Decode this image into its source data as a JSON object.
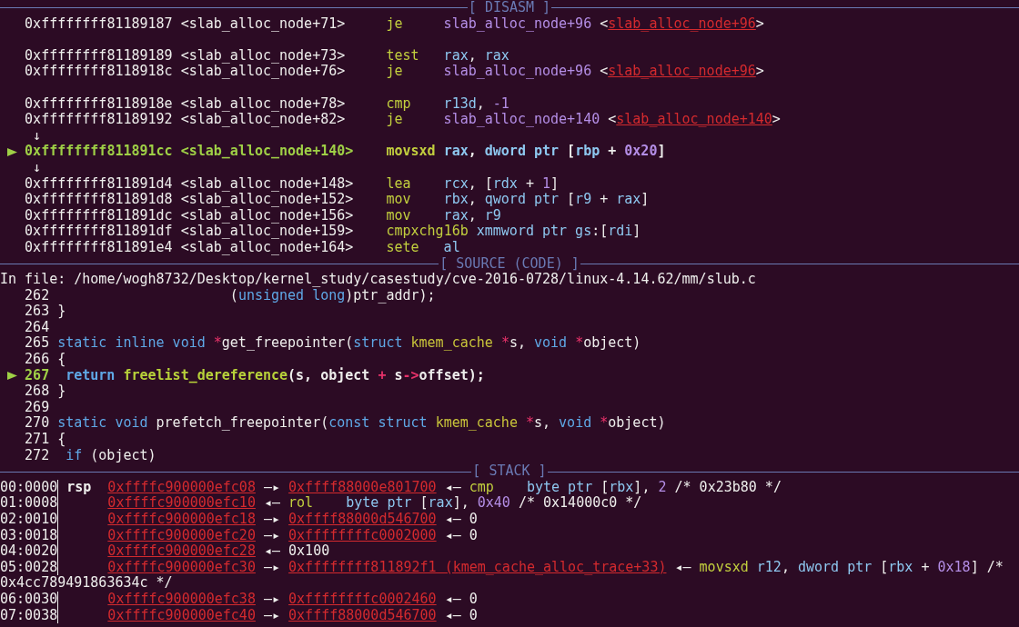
{
  "disasm": {
    "title": "[ DISASM ]",
    "lines": [
      {
        "kind": "instruction",
        "current": false,
        "address": "0xffffffff81189187",
        "symbol": "<slab_alloc_node+71>",
        "mnemonic": "je",
        "operands": [
          {
            "kind": "sym",
            "text": "slab_alloc_node+96"
          },
          {
            "kind": "plain",
            "text": " <"
          },
          {
            "kind": "link",
            "text": "slab_alloc_node+96"
          },
          {
            "kind": "plain",
            "text": ">"
          }
        ]
      },
      {
        "kind": "blank"
      },
      {
        "kind": "instruction",
        "current": false,
        "address": "0xffffffff81189189",
        "symbol": "<slab_alloc_node+73>",
        "mnemonic": "test",
        "operands": [
          {
            "kind": "reg",
            "text": "rax"
          },
          {
            "kind": "plain",
            "text": ", "
          },
          {
            "kind": "reg",
            "text": "rax"
          }
        ]
      },
      {
        "kind": "instruction",
        "current": false,
        "address": "0xffffffff8118918c",
        "symbol": "<slab_alloc_node+76>",
        "mnemonic": "je",
        "operands": [
          {
            "kind": "sym",
            "text": "slab_alloc_node+96"
          },
          {
            "kind": "plain",
            "text": " <"
          },
          {
            "kind": "link",
            "text": "slab_alloc_node+96"
          },
          {
            "kind": "plain",
            "text": ">"
          }
        ]
      },
      {
        "kind": "blank"
      },
      {
        "kind": "instruction",
        "current": false,
        "address": "0xffffffff8118918e",
        "symbol": "<slab_alloc_node+78>",
        "mnemonic": "cmp",
        "operands": [
          {
            "kind": "reg",
            "text": "r13d"
          },
          {
            "kind": "plain",
            "text": ", "
          },
          {
            "kind": "num",
            "text": "-1"
          }
        ]
      },
      {
        "kind": "instruction",
        "current": false,
        "address": "0xffffffff81189192",
        "symbol": "<slab_alloc_node+82>",
        "mnemonic": "je",
        "operands": [
          {
            "kind": "sym",
            "text": "slab_alloc_node+140"
          },
          {
            "kind": "plain",
            "text": " <"
          },
          {
            "kind": "link",
            "text": "slab_alloc_node+140"
          },
          {
            "kind": "plain",
            "text": ">"
          }
        ]
      },
      {
        "kind": "flow_arrow",
        "text": "↓"
      },
      {
        "kind": "instruction",
        "current": true,
        "address": "0xffffffff811891cc",
        "symbol": "<slab_alloc_node+140>",
        "mnemonic": "movsxd",
        "operands": [
          {
            "kind": "reg",
            "text": "rax"
          },
          {
            "kind": "plain",
            "text": ", "
          },
          {
            "kind": "reg",
            "text": "dword ptr"
          },
          {
            "kind": "plain",
            "text": " ["
          },
          {
            "kind": "reg",
            "text": "rbp"
          },
          {
            "kind": "plain",
            "text": " + "
          },
          {
            "kind": "num",
            "text": "0x20"
          },
          {
            "kind": "plain",
            "text": "]"
          }
        ]
      },
      {
        "kind": "flow_arrow",
        "text": "↓"
      },
      {
        "kind": "instruction",
        "current": false,
        "address": "0xffffffff811891d4",
        "symbol": "<slab_alloc_node+148>",
        "mnemonic": "lea",
        "operands": [
          {
            "kind": "reg",
            "text": "rcx"
          },
          {
            "kind": "plain",
            "text": ", ["
          },
          {
            "kind": "reg",
            "text": "rdx"
          },
          {
            "kind": "plain",
            "text": " + "
          },
          {
            "kind": "num",
            "text": "1"
          },
          {
            "kind": "plain",
            "text": "]"
          }
        ]
      },
      {
        "kind": "instruction",
        "current": false,
        "address": "0xffffffff811891d8",
        "symbol": "<slab_alloc_node+152>",
        "mnemonic": "mov",
        "operands": [
          {
            "kind": "reg",
            "text": "rbx"
          },
          {
            "kind": "plain",
            "text": ", "
          },
          {
            "kind": "reg",
            "text": "qword ptr"
          },
          {
            "kind": "plain",
            "text": " ["
          },
          {
            "kind": "reg",
            "text": "r9"
          },
          {
            "kind": "plain",
            "text": " + "
          },
          {
            "kind": "reg",
            "text": "rax"
          },
          {
            "kind": "plain",
            "text": "]"
          }
        ]
      },
      {
        "kind": "instruction",
        "current": false,
        "address": "0xffffffff811891dc",
        "symbol": "<slab_alloc_node+156>",
        "mnemonic": "mov",
        "operands": [
          {
            "kind": "reg",
            "text": "rax"
          },
          {
            "kind": "plain",
            "text": ", "
          },
          {
            "kind": "reg",
            "text": "r9"
          }
        ]
      },
      {
        "kind": "instruction",
        "current": false,
        "address": "0xffffffff811891df",
        "symbol": "<slab_alloc_node+159>",
        "mnemonic": "cmpxchg16b",
        "operands": [
          {
            "kind": "reg",
            "text": "xmmword ptr gs"
          },
          {
            "kind": "plain",
            "text": ":["
          },
          {
            "kind": "reg",
            "text": "rdi"
          },
          {
            "kind": "plain",
            "text": "]"
          }
        ]
      },
      {
        "kind": "instruction",
        "current": false,
        "address": "0xffffffff811891e4",
        "symbol": "<slab_alloc_node+164>",
        "mnemonic": "sete",
        "operands": [
          {
            "kind": "reg",
            "text": "al"
          }
        ]
      }
    ]
  },
  "source": {
    "title": "[ SOURCE (CODE) ]",
    "file": "In file: /home/wogh8732/Desktop/kernel_study/casestudy/cve-2016-0728/linux-4.14.62/mm/slub.c",
    "lines": [
      {
        "number": "262",
        "current": false,
        "code": [
          {
            "kind": "plain",
            "text": "                     ("
          },
          {
            "kind": "kw",
            "text": "unsigned long"
          },
          {
            "kind": "plain",
            "text": ")ptr_addr);"
          }
        ]
      },
      {
        "number": "263",
        "current": false,
        "code": [
          {
            "kind": "plain",
            "text": "}"
          }
        ]
      },
      {
        "number": "264",
        "current": false
      },
      {
        "number": "265",
        "current": false,
        "code": [
          {
            "kind": "kw",
            "text": "static inline void "
          },
          {
            "kind": "op",
            "text": "*"
          },
          {
            "kind": "plain",
            "text": "get_freepointer("
          },
          {
            "kind": "kw",
            "text": "struct "
          },
          {
            "kind": "type",
            "text": "kmem_cache "
          },
          {
            "kind": "op",
            "text": "*"
          },
          {
            "kind": "plain",
            "text": "s, "
          },
          {
            "kind": "kw",
            "text": "void "
          },
          {
            "kind": "op",
            "text": "*"
          },
          {
            "kind": "plain",
            "text": "object)"
          }
        ]
      },
      {
        "number": "266",
        "current": false,
        "code": [
          {
            "kind": "plain",
            "text": "{"
          }
        ]
      },
      {
        "number": "267",
        "current": true,
        "code": [
          {
            "kind": "kw",
            "text": " return "
          },
          {
            "kind": "func",
            "text": "freelist_dereference"
          },
          {
            "kind": "plain",
            "text": "(s, object "
          },
          {
            "kind": "op",
            "text": "+"
          },
          {
            "kind": "plain",
            "text": " s"
          },
          {
            "kind": "op",
            "text": "->"
          },
          {
            "kind": "plain",
            "text": "offset);"
          }
        ]
      },
      {
        "number": "268",
        "current": false,
        "code": [
          {
            "kind": "plain",
            "text": "}"
          }
        ]
      },
      {
        "number": "269",
        "current": false
      },
      {
        "number": "270",
        "current": false,
        "code": [
          {
            "kind": "kw",
            "text": "static void"
          },
          {
            "kind": "plain",
            "text": " prefetch_freepointer("
          },
          {
            "kind": "kw",
            "text": "const struct "
          },
          {
            "kind": "type",
            "text": "kmem_cache "
          },
          {
            "kind": "op",
            "text": "*"
          },
          {
            "kind": "plain",
            "text": "s, "
          },
          {
            "kind": "kw",
            "text": "void "
          },
          {
            "kind": "op",
            "text": "*"
          },
          {
            "kind": "plain",
            "text": "object)"
          }
        ]
      },
      {
        "number": "271",
        "current": false,
        "code": [
          {
            "kind": "plain",
            "text": "{"
          }
        ]
      },
      {
        "number": "272",
        "current": false,
        "code": [
          {
            "kind": "kw",
            "text": " if"
          },
          {
            "kind": "plain",
            "text": " (object)"
          }
        ]
      }
    ]
  },
  "stack": {
    "title": "[ STACK ]",
    "lines": [
      {
        "kind": "entry",
        "offset": "00:0000",
        "register": "rsp",
        "segs": [
          {
            "kind": "link",
            "text": "0xffffc900000efc08"
          },
          {
            "kind": "plain",
            "text": " —▸ "
          },
          {
            "kind": "link",
            "text": "0xffff88000e801700"
          },
          {
            "kind": "plain",
            "text": " ◂— "
          },
          {
            "kind": "mnem",
            "text": "cmp    "
          },
          {
            "kind": "reg",
            "text": "byte ptr"
          },
          {
            "kind": "plain",
            "text": " ["
          },
          {
            "kind": "reg",
            "text": "rbx"
          },
          {
            "kind": "plain",
            "text": "], "
          },
          {
            "kind": "num",
            "text": "2"
          },
          {
            "kind": "plain",
            "text": " /* 0x23b80 */"
          }
        ]
      },
      {
        "kind": "entry",
        "offset": "01:0008",
        "segs": [
          {
            "kind": "link",
            "text": "0xffffc900000efc10"
          },
          {
            "kind": "plain",
            "text": " ◂— "
          },
          {
            "kind": "mnem",
            "text": "rol    "
          },
          {
            "kind": "reg",
            "text": "byte ptr"
          },
          {
            "kind": "plain",
            "text": " ["
          },
          {
            "kind": "reg",
            "text": "rax"
          },
          {
            "kind": "plain",
            "text": "], "
          },
          {
            "kind": "num",
            "text": "0x40"
          },
          {
            "kind": "plain",
            "text": " /* 0x14000c0 */"
          }
        ]
      },
      {
        "kind": "entry",
        "offset": "02:0010",
        "segs": [
          {
            "kind": "link",
            "text": "0xffffc900000efc18"
          },
          {
            "kind": "plain",
            "text": " —▸ "
          },
          {
            "kind": "link",
            "text": "0xffff88000d546700"
          },
          {
            "kind": "plain",
            "text": " ◂— 0"
          }
        ]
      },
      {
        "kind": "entry",
        "offset": "03:0018",
        "segs": [
          {
            "kind": "link",
            "text": "0xffffc900000efc20"
          },
          {
            "kind": "plain",
            "text": " —▸ "
          },
          {
            "kind": "link",
            "text": "0xffffffffc0002000"
          },
          {
            "kind": "plain",
            "text": " ◂— 0"
          }
        ]
      },
      {
        "kind": "entry",
        "offset": "04:0020",
        "segs": [
          {
            "kind": "link",
            "text": "0xffffc900000efc28"
          },
          {
            "kind": "plain",
            "text": " ◂— 0x100"
          }
        ]
      },
      {
        "kind": "entry",
        "offset": "05:0028",
        "segs": [
          {
            "kind": "link",
            "text": "0xffffc900000efc30"
          },
          {
            "kind": "plain",
            "text": " —▸ "
          },
          {
            "kind": "link",
            "text": "0xffffffff811892f1 (kmem_cache_alloc_trace+33)"
          },
          {
            "kind": "plain",
            "text": " ◂— "
          },
          {
            "kind": "mnem",
            "text": "movsxd "
          },
          {
            "kind": "reg",
            "text": "r12"
          },
          {
            "kind": "plain",
            "text": ", "
          },
          {
            "kind": "reg",
            "text": "dword ptr"
          },
          {
            "kind": "plain",
            "text": " ["
          },
          {
            "kind": "reg",
            "text": "rbx"
          },
          {
            "kind": "plain",
            "text": " + "
          },
          {
            "kind": "num",
            "text": "0x18"
          },
          {
            "kind": "plain",
            "text": "] /*"
          }
        ]
      },
      {
        "kind": "continuation",
        "segs": [
          {
            "kind": "plain",
            "text": "0x4cc789491863634c */"
          }
        ]
      },
      {
        "kind": "entry",
        "offset": "06:0030",
        "segs": [
          {
            "kind": "link",
            "text": "0xffffc900000efc38"
          },
          {
            "kind": "plain",
            "text": " —▸ "
          },
          {
            "kind": "link",
            "text": "0xffffffffc0002460"
          },
          {
            "kind": "plain",
            "text": " ◂— 0"
          }
        ]
      },
      {
        "kind": "entry",
        "offset": "07:0038",
        "segs": [
          {
            "kind": "link",
            "text": "0xffffc900000efc40"
          },
          {
            "kind": "plain",
            "text": " —▸ "
          },
          {
            "kind": "link",
            "text": "0xffff88000d546700"
          },
          {
            "kind": "plain",
            "text": " ◂— 0"
          }
        ]
      }
    ]
  }
}
